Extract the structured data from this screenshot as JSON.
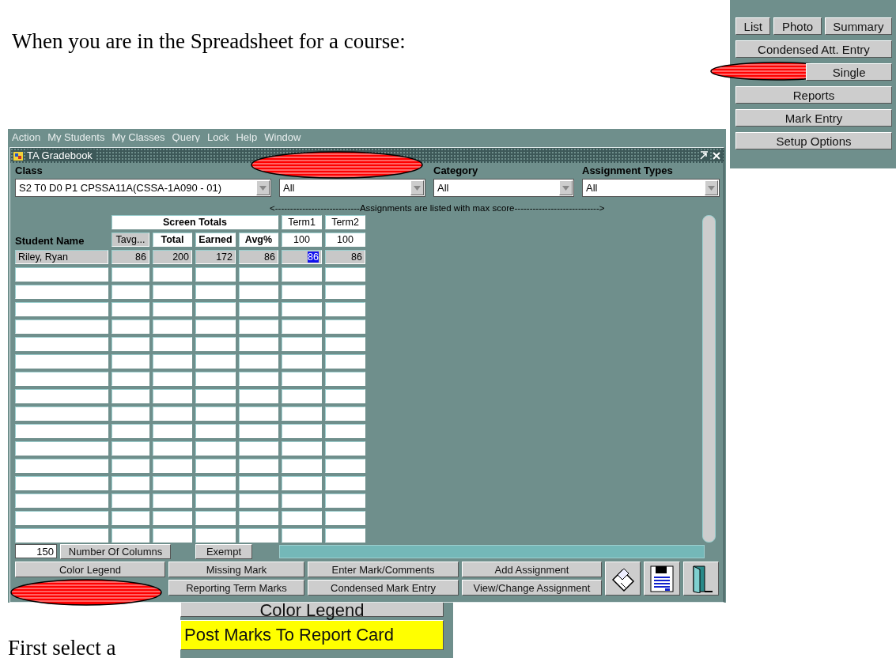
{
  "intro_text": "When you are in the Spreadsheet for a course:",
  "attendance_panel": {
    "rows": [
      {
        "buttons": [
          {
            "label": "List",
            "circled": false
          },
          {
            "label": "Photo",
            "circled": false
          },
          {
            "label": "Summary",
            "circled": false
          }
        ]
      },
      {
        "buttons": [
          {
            "label": "Condensed Att. Entry",
            "circled": false
          }
        ]
      },
      {
        "buttons": [
          {
            "circled": true
          },
          {
            "label": "Single",
            "circled": false
          }
        ]
      },
      {
        "buttons": [
          {
            "label": "Reports",
            "circled": false
          }
        ]
      },
      {
        "buttons": [
          {
            "label": "Mark Entry",
            "circled": false
          }
        ]
      },
      {
        "buttons": [
          {
            "label": "Setup Options",
            "circled": false
          }
        ]
      }
    ]
  },
  "window": {
    "menu": [
      "Action",
      "My Students",
      "My Classes",
      "Query",
      "Lock",
      "Help",
      "Window"
    ],
    "title": "TA Gradebook",
    "filters": [
      {
        "label": "Class",
        "value": "S2 T0 D0 P1 CPSSA11A(CSSA-1A090 - 01)",
        "circled": false
      },
      {
        "value": "All",
        "circled": true
      },
      {
        "label": "Category",
        "value": "All",
        "circled": false
      },
      {
        "label": "Assignment Types",
        "value": "All",
        "circled": false
      }
    ],
    "hint": "<----------------------------Assignments are listed with max score---------------------------->",
    "grid": {
      "group_header": "Screen Totals",
      "term_headers": [
        "Term1",
        "Term2"
      ],
      "name_header": "Student Name",
      "columns": [
        {
          "label": "Tavg...",
          "kind": "button"
        },
        {
          "label": "Total",
          "kind": "total"
        },
        {
          "label": "Earned",
          "kind": "total"
        },
        {
          "label": "Avg%",
          "kind": "total"
        },
        {
          "label": "100",
          "kind": "max"
        },
        {
          "label": "100",
          "kind": "max"
        }
      ],
      "rows": [
        {
          "name": "Riley, Ryan",
          "cells": [
            {
              "value": "86",
              "selected": false
            },
            {
              "value": "200",
              "selected": false
            },
            {
              "value": "172",
              "selected": false
            },
            {
              "value": "86",
              "selected": false
            },
            {
              "value": "86",
              "selected": true
            },
            {
              "value": "86",
              "selected": false
            }
          ]
        }
      ]
    },
    "columns_count": "150",
    "columns_button": "Number Of Columns",
    "exempt_button": "Exempt",
    "action_buttons": [
      {
        "label": "Color Legend",
        "circled": false
      },
      {
        "label": "Missing Mark",
        "circled": false
      },
      {
        "label": "Enter Mark/Comments",
        "circled": false
      },
      {
        "label": "Add Assignment",
        "circled": false
      },
      {
        "circled": true
      },
      {
        "label": "Reporting Term Marks",
        "circled": false
      },
      {
        "label": "Condensed Mark Entry",
        "circled": false
      },
      {
        "label": "View/Change Assignment",
        "circled": false
      }
    ]
  },
  "closing_text": "First select a",
  "inset": {
    "buttons": [
      {
        "label": "Color Legend",
        "highlighted": false
      },
      {
        "label": "Post Marks To Report Card",
        "highlighted": true
      }
    ]
  }
}
